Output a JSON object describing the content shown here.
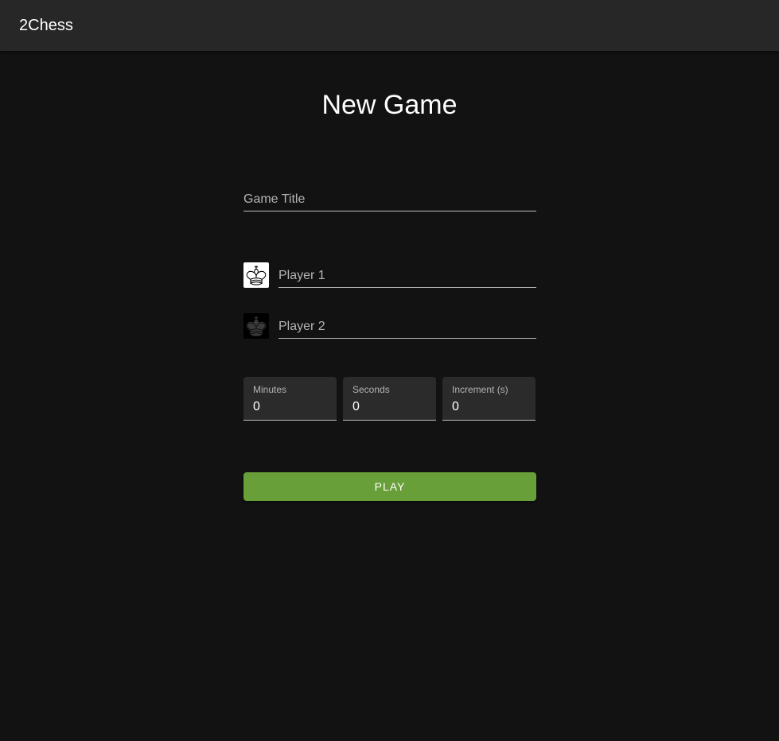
{
  "appbar": {
    "brand": "2Chess"
  },
  "page": {
    "title": "New Game"
  },
  "form": {
    "game_title": {
      "placeholder": "Game Title",
      "value": ""
    },
    "player1": {
      "placeholder": "Player 1",
      "value": "",
      "icon": "white-king-icon"
    },
    "player2": {
      "placeholder": "Player 2",
      "value": "",
      "icon": "black-king-icon"
    },
    "time": {
      "minutes": {
        "label": "Minutes",
        "value": "0"
      },
      "seconds": {
        "label": "Seconds",
        "value": "0"
      },
      "increment": {
        "label": "Increment (s)",
        "value": "0"
      }
    },
    "play_label": "PLAY"
  },
  "colors": {
    "background": "#121212",
    "appbar": "#272727",
    "field_fill": "#2b2b2b",
    "play_button": "#689f38"
  }
}
